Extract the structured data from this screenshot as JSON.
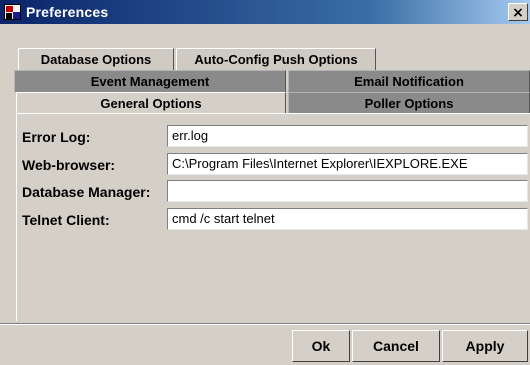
{
  "window": {
    "title": "Preferences",
    "close_label": "×",
    "title_bar_colors": [
      "#0a246a",
      "#a6caf0"
    ]
  },
  "tabs": {
    "row1": [
      "Database Options",
      "Auto-Config Push Options"
    ],
    "row2": [
      "Event Management",
      "Email Notification"
    ],
    "row3": [
      "General Options",
      "Poller Options"
    ],
    "selected": "General Options"
  },
  "form": {
    "fields": [
      {
        "label": "Error Log:",
        "value": "err.log"
      },
      {
        "label": "Web-browser:",
        "value": "C:\\Program Files\\Internet Explorer\\IEXPLORE.EXE"
      },
      {
        "label": "Database Manager:",
        "value": ""
      },
      {
        "label": "Telnet Client:",
        "value": "cmd /c start telnet"
      }
    ]
  },
  "buttons": {
    "ok": "Ok",
    "cancel": "Cancel",
    "apply": "Apply"
  }
}
